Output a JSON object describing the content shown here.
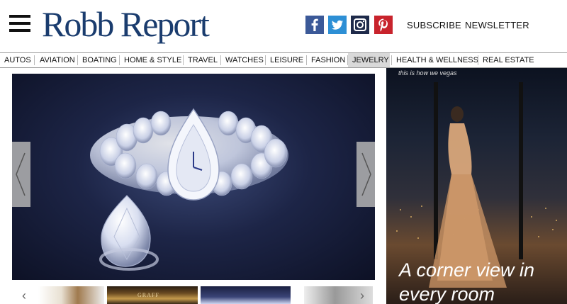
{
  "brand": {
    "logo_text": "Robb Report",
    "logo_color": "#1a3c6e"
  },
  "header": {
    "menu_icon": "hamburger-menu-icon",
    "social": [
      {
        "name": "facebook",
        "icon": "facebook-icon",
        "color": "#3b5998"
      },
      {
        "name": "twitter",
        "icon": "twitter-icon",
        "color": "#2d8fd5"
      },
      {
        "name": "instagram",
        "icon": "instagram-icon",
        "color": "#1e2a4a"
      },
      {
        "name": "pinterest",
        "icon": "pinterest-icon",
        "color": "#c8232c"
      }
    ],
    "links": {
      "subscribe": "SUBSCRIBE",
      "newsletter": "NEWSLETTER"
    }
  },
  "nav": {
    "items": [
      {
        "label": "AUTOS"
      },
      {
        "label": "AVIATION"
      },
      {
        "label": "BOATING"
      },
      {
        "label": "HOME & STYLE"
      },
      {
        "label": "TRAVEL"
      },
      {
        "label": "WATCHES"
      },
      {
        "label": "LEISURE"
      },
      {
        "label": "FASHION"
      },
      {
        "label": "JEWELRY",
        "active": true
      },
      {
        "label": "HEALTH & WELLNESS"
      },
      {
        "label": "REAL ESTATE"
      }
    ]
  },
  "carousel": {
    "prev_icon": "chevron-left-icon",
    "next_icon": "chevron-right-icon",
    "thumbnails": [
      {
        "label": ""
      },
      {
        "label": "GRAFF"
      },
      {
        "label": ""
      },
      {
        "label": ""
      }
    ]
  },
  "ad": {
    "tagline": "this is how we vegas",
    "headline": "A corner view in every room"
  }
}
